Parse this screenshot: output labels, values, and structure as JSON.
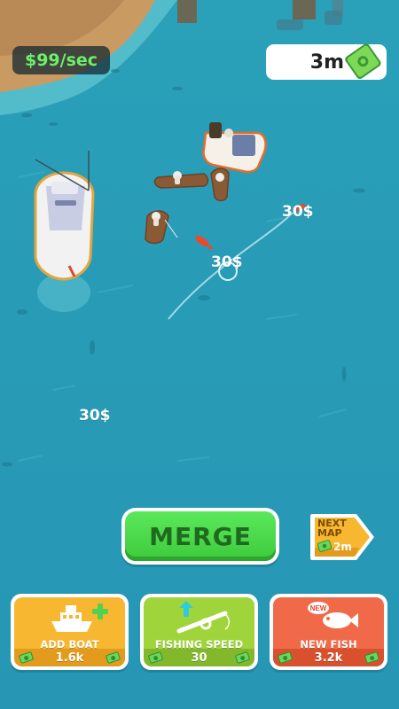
{
  "hud": {
    "income_rate": "$99/sec",
    "cash": "3m",
    "cash_icon": "money-bill-icon"
  },
  "floating_earnings": [
    "30$",
    "30$",
    "30$"
  ],
  "merge_button": {
    "label": "MERGE"
  },
  "next_map": {
    "label_line1": "NEXT",
    "label_line2": "MAP",
    "cost": "2m"
  },
  "upgrades": [
    {
      "id": "add-boat",
      "title": "ADD BOAT",
      "cost": "1.6k",
      "icon": "boat-plus-icon",
      "color": "#f7b731"
    },
    {
      "id": "fishing-speed",
      "title": "FISHING SPEED",
      "cost": "30",
      "icon": "fishing-rod-icon",
      "color": "#9fd53a"
    },
    {
      "id": "new-fish",
      "title": "NEW FISH",
      "cost": "3.2k",
      "icon": "fish-new-icon",
      "color": "#f06a4a",
      "badge": "NEW"
    }
  ],
  "colors": {
    "water": "#2a9fb8",
    "sand": "#c99a62",
    "merge_green": "#3dcb3d",
    "income_green": "#6bf06b"
  }
}
